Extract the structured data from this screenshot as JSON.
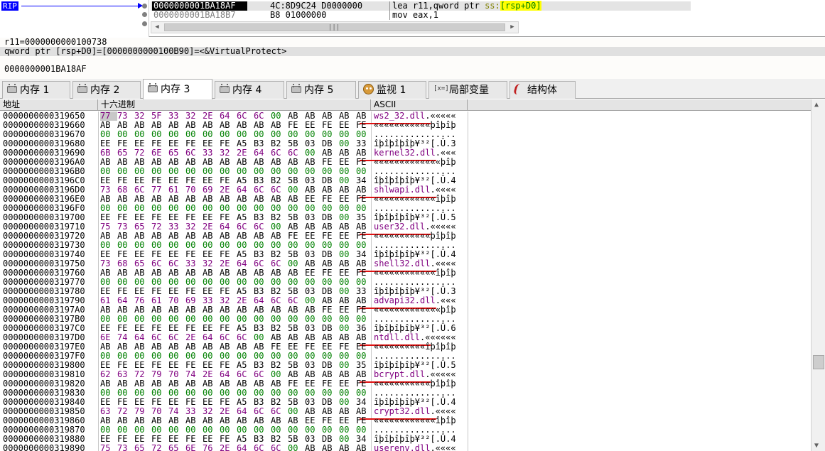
{
  "disasm": {
    "rip_label": "RIP",
    "rows": [
      {
        "address": "0000000001BA18AF",
        "bytes": "4C:8D9C24 D0000000",
        "mnemonic": "lea",
        "operands_pre": " r11,qword ptr ",
        "segment": "ss:",
        "bracket": "[rsp+D0]"
      },
      {
        "address": "0000000001BA18B7",
        "bytes": "B8 01000000",
        "mnemonic": "mov",
        "operands_pre": " eax,1",
        "segment": "",
        "bracket": ""
      }
    ],
    "scroll_grip": "|||"
  },
  "info": {
    "line1": "r11=0000000000100738",
    "line2": "qword ptr [rsp+D0]=[0000000000100B90]=<&VirtualProtect>",
    "line3": "0000000001BA18AF"
  },
  "tabs": [
    {
      "label": "内存 1",
      "icon": "memory-chip-icon",
      "active": false
    },
    {
      "label": "内存 2",
      "icon": "memory-chip-icon",
      "active": false
    },
    {
      "label": "内存 3",
      "icon": "memory-chip-icon",
      "active": true
    },
    {
      "label": "内存 4",
      "icon": "memory-chip-icon",
      "active": false
    },
    {
      "label": "内存 5",
      "icon": "memory-chip-icon",
      "active": false
    },
    {
      "label": "监视 1",
      "icon": "watch-icon",
      "active": false
    },
    {
      "label": "局部变量",
      "icon": "locals-icon",
      "active": false
    },
    {
      "label": "结构体",
      "icon": "struct-icon",
      "active": false
    }
  ],
  "locals_icon_text": "[x=]",
  "dump": {
    "headers": {
      "address": "地址",
      "hex": "十六进制",
      "ascii": "ASCII"
    },
    "rows": [
      {
        "addr": "0000000000319650",
        "hex": "77 73 32 5F 33 32 2E 64 6C 6C 00 AB AB AB AB AB",
        "ascii": "ws2_32.dll.«««««",
        "strlen": 10,
        "sel": 0
      },
      {
        "addr": "0000000000319660",
        "hex": "AB AB AB AB AB AB AB AB AB AB AB FE EE FE EE FE",
        "ascii": "«««««««««««þîþîþ",
        "strlen": 0
      },
      {
        "addr": "0000000000319670",
        "hex": "00 00 00 00 00 00 00 00 00 00 00 00 00 00 00 00",
        "ascii": "................",
        "strlen": 0
      },
      {
        "addr": "0000000000319680",
        "hex": "EE FE EE FE EE FE EE FE A5 B3 B2 5B 03 DB 00 33",
        "ascii": "îþîþîþîþ¥³²[.Û.3",
        "strlen": 0
      },
      {
        "addr": "0000000000319690",
        "hex": "6B 65 72 6E 65 6C 33 32 2E 64 6C 6C 00 AB AB AB",
        "ascii": "kernel32.dll.«««",
        "strlen": 12
      },
      {
        "addr": "00000000003196A0",
        "hex": "AB AB AB AB AB AB AB AB AB AB AB AB AB FE EE FE",
        "ascii": "«««««««««««««þîþ",
        "strlen": 0
      },
      {
        "addr": "00000000003196B0",
        "hex": "00 00 00 00 00 00 00 00 00 00 00 00 00 00 00 00",
        "ascii": "................",
        "strlen": 0
      },
      {
        "addr": "00000000003196C0",
        "hex": "EE FE EE FE EE FE EE FE A5 B3 B2 5B 03 DB 00 34",
        "ascii": "îþîþîþîþ¥³²[.Û.4",
        "strlen": 0
      },
      {
        "addr": "00000000003196D0",
        "hex": "73 68 6C 77 61 70 69 2E 64 6C 6C 00 AB AB AB AB",
        "ascii": "shlwapi.dll.««««",
        "strlen": 11
      },
      {
        "addr": "00000000003196E0",
        "hex": "AB AB AB AB AB AB AB AB AB AB AB AB EE FE EE FE",
        "ascii": "««««««««««««îþîþ",
        "strlen": 0
      },
      {
        "addr": "00000000003196F0",
        "hex": "00 00 00 00 00 00 00 00 00 00 00 00 00 00 00 00",
        "ascii": "................",
        "strlen": 0
      },
      {
        "addr": "0000000000319700",
        "hex": "EE FE EE FE EE FE EE FE A5 B3 B2 5B 03 DB 00 35",
        "ascii": "îþîþîþîþ¥³²[.Û.5",
        "strlen": 0
      },
      {
        "addr": "0000000000319710",
        "hex": "75 73 65 72 33 32 2E 64 6C 6C 00 AB AB AB AB AB",
        "ascii": "user32.dll.«««««",
        "strlen": 10
      },
      {
        "addr": "0000000000319720",
        "hex": "AB AB AB AB AB AB AB AB AB AB AB FE EE FE EE FE",
        "ascii": "«««««««««««þîþîþ",
        "strlen": 0
      },
      {
        "addr": "0000000000319730",
        "hex": "00 00 00 00 00 00 00 00 00 00 00 00 00 00 00 00",
        "ascii": "................",
        "strlen": 0
      },
      {
        "addr": "0000000000319740",
        "hex": "EE FE EE FE EE FE EE FE A5 B3 B2 5B 03 DB 00 34",
        "ascii": "îþîþîþîþ¥³²[.Û.4",
        "strlen": 0
      },
      {
        "addr": "0000000000319750",
        "hex": "73 68 65 6C 6C 33 32 2E 64 6C 6C 00 AB AB AB AB",
        "ascii": "shell32.dll.««««",
        "strlen": 11
      },
      {
        "addr": "0000000000319760",
        "hex": "AB AB AB AB AB AB AB AB AB AB AB AB EE FE EE FE",
        "ascii": "««««««««««««îþîþ",
        "strlen": 0
      },
      {
        "addr": "0000000000319770",
        "hex": "00 00 00 00 00 00 00 00 00 00 00 00 00 00 00 00",
        "ascii": "................",
        "strlen": 0
      },
      {
        "addr": "0000000000319780",
        "hex": "EE FE EE FE EE FE EE FE A5 B3 B2 5B 03 DB 00 33",
        "ascii": "îþîþîþîþ¥³²[.Û.3",
        "strlen": 0
      },
      {
        "addr": "0000000000319790",
        "hex": "61 64 76 61 70 69 33 32 2E 64 6C 6C 00 AB AB AB",
        "ascii": "advapi32.dll.«««",
        "strlen": 12
      },
      {
        "addr": "00000000003197A0",
        "hex": "AB AB AB AB AB AB AB AB AB AB AB AB AB FE EE FE",
        "ascii": "«««««««««««««þîþ",
        "strlen": 0
      },
      {
        "addr": "00000000003197B0",
        "hex": "00 00 00 00 00 00 00 00 00 00 00 00 00 00 00 00",
        "ascii": "................",
        "strlen": 0
      },
      {
        "addr": "00000000003197C0",
        "hex": "EE FE EE FE EE FE EE FE A5 B3 B2 5B 03 DB 00 36",
        "ascii": "îþîþîþîþ¥³²[.Û.6",
        "strlen": 0
      },
      {
        "addr": "00000000003197D0",
        "hex": "6E 74 64 6C 6C 2E 64 6C 6C 00 AB AB AB AB AB AB",
        "ascii": "ntdll.dll.««««««",
        "strlen": 9
      },
      {
        "addr": "00000000003197E0",
        "hex": "AB AB AB AB AB AB AB AB AB AB FE EE FE EE FE EE",
        "ascii": "««««««««««îþîþîþ",
        "strlen": 0
      },
      {
        "addr": "00000000003197F0",
        "hex": "00 00 00 00 00 00 00 00 00 00 00 00 00 00 00 00",
        "ascii": "................",
        "strlen": 0
      },
      {
        "addr": "0000000000319800",
        "hex": "EE FE EE FE EE FE EE FE A5 B3 B2 5B 03 DB 00 35",
        "ascii": "îþîþîþîþ¥³²[.Û.5",
        "strlen": 0
      },
      {
        "addr": "0000000000319810",
        "hex": "62 63 72 79 70 74 2E 64 6C 6C 00 AB AB AB AB AB",
        "ascii": "bcrypt.dll.«««««",
        "strlen": 10
      },
      {
        "addr": "0000000000319820",
        "hex": "AB AB AB AB AB AB AB AB AB AB AB FE EE FE EE FE",
        "ascii": "«««««««««««þîþîþ",
        "strlen": 0
      },
      {
        "addr": "0000000000319830",
        "hex": "00 00 00 00 00 00 00 00 00 00 00 00 00 00 00 00",
        "ascii": "................",
        "strlen": 0
      },
      {
        "addr": "0000000000319840",
        "hex": "EE FE EE FE EE FE EE FE A5 B3 B2 5B 03 DB 00 34",
        "ascii": "îþîþîþîþ¥³²[.Û.4",
        "strlen": 0
      },
      {
        "addr": "0000000000319850",
        "hex": "63 72 79 70 74 33 32 2E 64 6C 6C 00 AB AB AB AB",
        "ascii": "crypt32.dll.««««",
        "strlen": 11
      },
      {
        "addr": "0000000000319860",
        "hex": "AB AB AB AB AB AB AB AB AB AB AB AB EE FE EE FE",
        "ascii": "««««««««««««îþîþ",
        "strlen": 0
      },
      {
        "addr": "0000000000319870",
        "hex": "00 00 00 00 00 00 00 00 00 00 00 00 00 00 00 00",
        "ascii": "................",
        "strlen": 0
      },
      {
        "addr": "0000000000319880",
        "hex": "EE FE EE FE EE FE EE FE A5 B3 B2 5B 03 DB 00 34",
        "ascii": "îþîþîþîþ¥³²[.Û.4",
        "strlen": 0
      },
      {
        "addr": "0000000000319890",
        "hex": "75 73 65 72 65 6E 76 2E 64 6C 6C 00 AB AB AB AB",
        "ascii": "userenv.dll.««««",
        "strlen": 11
      }
    ]
  },
  "colors": {
    "rip": "#0000ff",
    "hex_zero": "#008000",
    "hex_string": "#800080",
    "annotation": "#e01010",
    "selection": "#c8c8c8"
  }
}
